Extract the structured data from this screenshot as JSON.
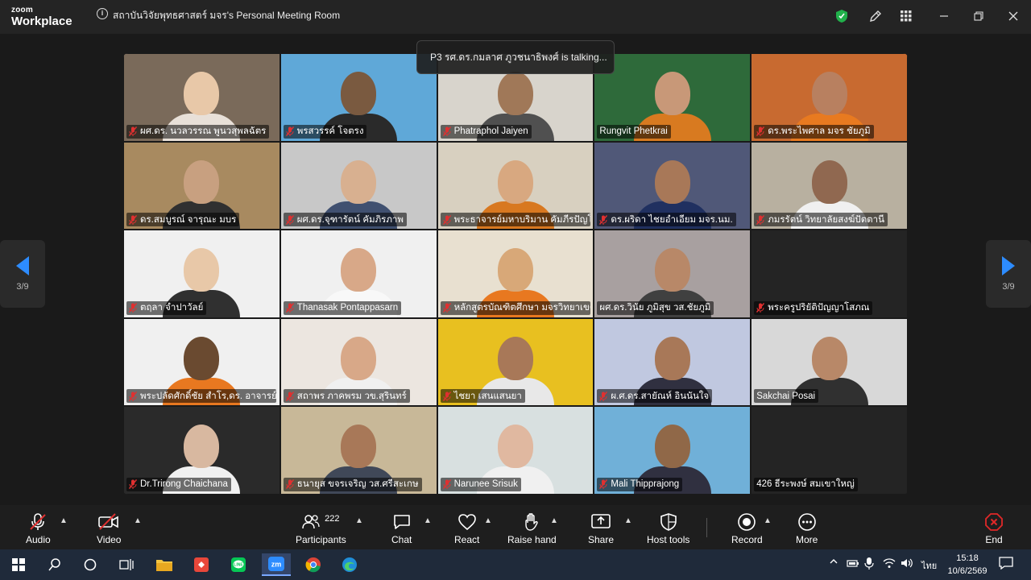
{
  "window": {
    "logo_line1": "zoom",
    "logo_line2": "Workplace",
    "title": "สถาบันวิจัยพุทธศาสตร์ มจร's Personal Meeting Room"
  },
  "talking_indicator": "P3 รศ.ดร.กมลาศ ภูวชนาธิพงศ์ is talking...",
  "pagination": {
    "left": "3/9",
    "right": "3/9"
  },
  "participants": [
    {
      "name": "ผศ.ดร. นวลวรรณ พูนวสุพลฉัตร",
      "muted": true,
      "bg": "#7a6a5a",
      "skin": "#e8c8a8",
      "shirt": "#e8e0d8",
      "video": true
    },
    {
      "name": "พรสวรรค์ โจตรง",
      "muted": true,
      "bg": "#5fa8d8",
      "skin": "#7a5a40",
      "shirt": "#2a2a2a",
      "video": true
    },
    {
      "name": "Phatraphol Jaiyen",
      "muted": true,
      "bg": "#d8d4cc",
      "skin": "#a07858",
      "shirt": "#505050",
      "video": true
    },
    {
      "name": "Rungvit Phetkrai",
      "muted": false,
      "bg": "#2e6a3a",
      "skin": "#c89878",
      "shirt": "#d87a20",
      "video": true
    },
    {
      "name": "ดร.พระไพศาล มจร ชัยภูมิ",
      "muted": true,
      "bg": "#c86a30",
      "skin": "#b88060",
      "shirt": "#e87a20",
      "video": true
    },
    {
      "name": "ดร.สมบูรณ์ จารุณะ มบร",
      "muted": true,
      "bg": "#a88a60",
      "skin": "#c8a080",
      "shirt": "#303030",
      "video": true
    },
    {
      "name": "ผศ.ดร.จุฑารัตน์ คัมภิรภาพ",
      "muted": true,
      "bg": "#c8c8c8",
      "skin": "#d8b090",
      "shirt": "#405070",
      "video": true
    },
    {
      "name": "พระธาจารย์มหาบริมาน คัมภีรปัญโญ ดร.",
      "muted": true,
      "bg": "#d8d0c0",
      "skin": "#d8a880",
      "shirt": "#d87820",
      "video": true
    },
    {
      "name": "ดร.ผริดา ไชยอำเอียม มจร.นม.",
      "muted": true,
      "bg": "#505878",
      "skin": "#a87858",
      "shirt": "#203060",
      "video": true
    },
    {
      "name": "ภมรรัตน์ วิทยาลัยสงฆ์ปัตตานี",
      "muted": true,
      "bg": "#b8b0a0",
      "skin": "#906850",
      "shirt": "#f0f0f0",
      "video": true
    },
    {
      "name": "ตฤลา จำปาวัลย์",
      "muted": true,
      "bg": "#f0f0f0",
      "skin": "#e8c8a8",
      "shirt": "#303030",
      "video": true
    },
    {
      "name": "Thanasak Pontappasarn",
      "muted": true,
      "bg": "#f0f0f0",
      "skin": "#d8a888",
      "shirt": "#f8f8f8",
      "video": true
    },
    {
      "name": "หลักสูตรบัณฑิตศึกษา มจรวิทยาเขต...",
      "muted": true,
      "bg": "#e8e0d0",
      "skin": "#d8a878",
      "shirt": "#e87820",
      "video": true
    },
    {
      "name": "ผศ.ดร.วินัย ภูมิสุข วส.ชัยภูมิ",
      "muted": false,
      "bg": "#a8a0a0",
      "skin": "#b88868",
      "shirt": "#404040",
      "video": true
    },
    {
      "name": "พระครูปริยัติปัญญาโสภณ",
      "muted": true,
      "bg": "#242424",
      "skin": "",
      "shirt": "",
      "video": false
    },
    {
      "name": "พระปลัดศักดิ์ชัย สำโร,ดร. อาจารย์/...",
      "muted": true,
      "bg": "#f0f0f0",
      "skin": "#6a4a30",
      "shirt": "#e87820",
      "video": true
    },
    {
      "name": "สถาพร ภาคพรม วข.สุรินทร์",
      "muted": true,
      "bg": "#ece6e0",
      "skin": "#d8a888",
      "shirt": "#f0f0f0",
      "video": true
    },
    {
      "name": "ไชยา เสนแสนยา",
      "muted": true,
      "bg": "#e8c020",
      "skin": "#a87858",
      "shirt": "#e8e8e8",
      "video": true
    },
    {
      "name": "ผ.ศ.ดร.สายัณห์ อินนันใจ",
      "muted": true,
      "bg": "#c0c8e0",
      "skin": "#a87858",
      "shirt": "#303040",
      "video": true
    },
    {
      "name": "Sakchai Posai",
      "muted": false,
      "bg": "#d8d8d8",
      "skin": "#b88868",
      "shirt": "#303030",
      "video": true
    },
    {
      "name": "Dr.Trirong Chaichana",
      "muted": true,
      "bg": "#2a2a2a",
      "skin": "#d8b8a0",
      "shirt": "#f0f0f0",
      "video": true
    },
    {
      "name": "ธนายุส ขจรเจริญ วส.ศรีสะเกษ",
      "muted": true,
      "bg": "#c8b898",
      "skin": "#a87858",
      "shirt": "#404858",
      "video": true
    },
    {
      "name": "Narunee Srisuk",
      "muted": true,
      "bg": "#d8e0e0",
      "skin": "#e0b8a0",
      "shirt": "#f0f0f0",
      "video": true
    },
    {
      "name": "Mali Thipprajong",
      "muted": true,
      "bg": "#70b0d8",
      "skin": "#906848",
      "shirt": "#303040",
      "video": true
    },
    {
      "name": "426 ธีระพงษ์ สมเขาใหญ่",
      "muted": false,
      "bg": "#242424",
      "skin": "",
      "shirt": "",
      "video": false
    }
  ],
  "toolbar": {
    "audio": "Audio",
    "video": "Video",
    "participants": "Participants",
    "participants_count": "222",
    "chat": "Chat",
    "react": "React",
    "raise_hand": "Raise hand",
    "share": "Share",
    "host_tools": "Host tools",
    "record": "Record",
    "more": "More",
    "end": "End"
  },
  "taskbar": {
    "language": "ไทย",
    "time": "15:18",
    "date": "10/6/2569",
    "zoom_label": "zm"
  },
  "colors": {
    "accent_blue": "#2d8cff",
    "end_red": "#e02828",
    "muted_red": "#e03030",
    "shield_green": "#21b14b"
  }
}
